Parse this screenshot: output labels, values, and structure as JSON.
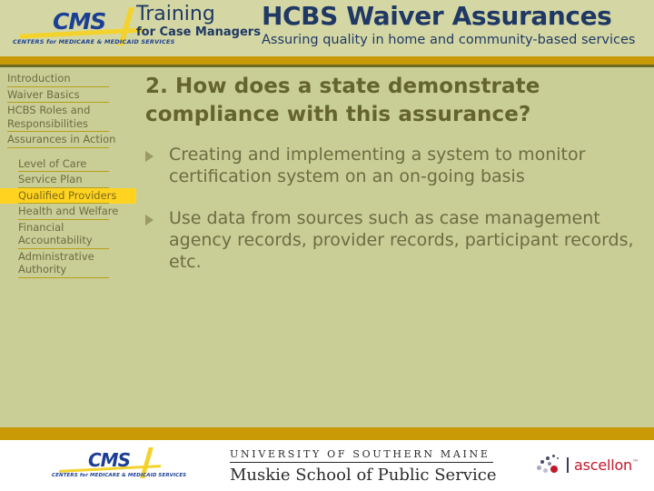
{
  "header": {
    "cms_logo": {
      "wordmark": "CMS",
      "tagline": "CENTERS for MEDICARE & MEDICAID SERVICES"
    },
    "training_title": "Training",
    "training_subtitle": "for Case Managers",
    "course_title": "HCBS Waiver Assurances",
    "course_subtitle": "Assuring quality in home and community-based services"
  },
  "sidebar": {
    "items": [
      {
        "label": "Introduction",
        "sub": false,
        "active": false
      },
      {
        "label": "Waiver Basics",
        "sub": false,
        "active": false
      },
      {
        "label": "HCBS Roles and Responsibilities",
        "sub": false,
        "active": false
      },
      {
        "label": "Assurances in Action",
        "sub": false,
        "active": false
      },
      {
        "label": "Level of Care",
        "sub": true,
        "active": false
      },
      {
        "label": "Service Plan",
        "sub": true,
        "active": false
      },
      {
        "label": "Qualified Providers",
        "sub": true,
        "active": true
      },
      {
        "label": "Health and Welfare",
        "sub": true,
        "active": false
      },
      {
        "label": "Financial Accountability",
        "sub": true,
        "active": false
      },
      {
        "label": "Administrative Authority",
        "sub": true,
        "active": false
      }
    ]
  },
  "main": {
    "title": "2. How does a state demonstrate compliance with this assurance?",
    "bullets": [
      {
        "glyph": "arrow-bullet",
        "text": "Creating and implementing a system to monitor certification system on an on-going basis"
      },
      {
        "glyph": "arrow-bullet",
        "text": "Use data from sources such as case management agency records, provider records, participant records, etc."
      }
    ]
  },
  "footer": {
    "cms_logo": {
      "wordmark": "CMS",
      "tagline": "CENTERS for MEDICARE & MEDICAID SERVICES"
    },
    "usm_line1": "UNIVERSITY OF SOUTHERN MAINE",
    "usm_line2": "Muskie School of Public Service",
    "ascellon_word": "ascellon",
    "ascellon_tm": "™"
  },
  "colors": {
    "body_bg": "#c9cd96",
    "header_bg": "#d4d7a4",
    "gold_bar": "#c99a06",
    "olive_line": "#6b6b23",
    "nav_text": "#6d6d42",
    "nav_rule": "#b5a11c",
    "active_bg": "#ffd320",
    "title_text": "#63642e",
    "logo_blue": "#1f3864",
    "ascellon_red": "#c0182b"
  }
}
